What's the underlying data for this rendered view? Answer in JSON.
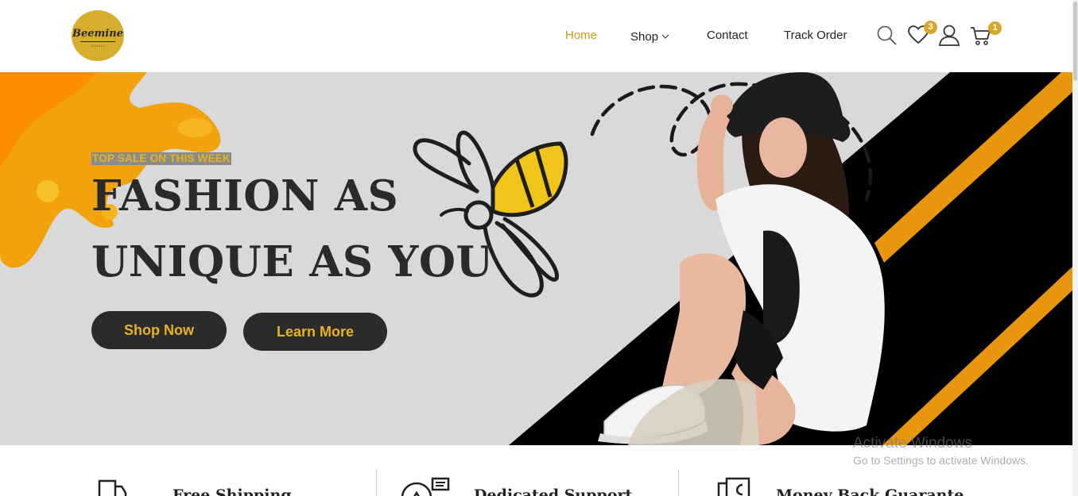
{
  "brand": {
    "logo_text": "Beemine"
  },
  "nav": {
    "home": "Home",
    "shop": "Shop",
    "contact": "Contact",
    "track_order": "Track Order"
  },
  "header_icons": {
    "search": "search-icon",
    "wishlist": "heart-icon",
    "wishlist_count": "3",
    "account": "user-icon",
    "cart": "cart-icon",
    "cart_count": "1"
  },
  "hero": {
    "tagline": "TOP SALE ON THIS WEEK",
    "headline_line1": "FASHION AS",
    "headline_line2": "UNIQUE AS YOU",
    "shop_button": "Shop Now",
    "learn_button": "Learn More"
  },
  "features": [
    {
      "title": "Free Shipping",
      "icon": "truck-icon"
    },
    {
      "title": "Dedicated Support",
      "icon": "support-icon"
    },
    {
      "title": "Money Back Guarante",
      "icon": "money-icon"
    }
  ],
  "watermark": {
    "line1": "Activate Windows",
    "line2": "Go to Settings to activate Windows."
  },
  "colors": {
    "accent": "#c79a1c",
    "badge": "#d6a82a",
    "button_bg": "#2b2b2b",
    "button_text": "#e7b320",
    "hero_bg": "#d9d9d9",
    "stripe": "#e8960e"
  }
}
